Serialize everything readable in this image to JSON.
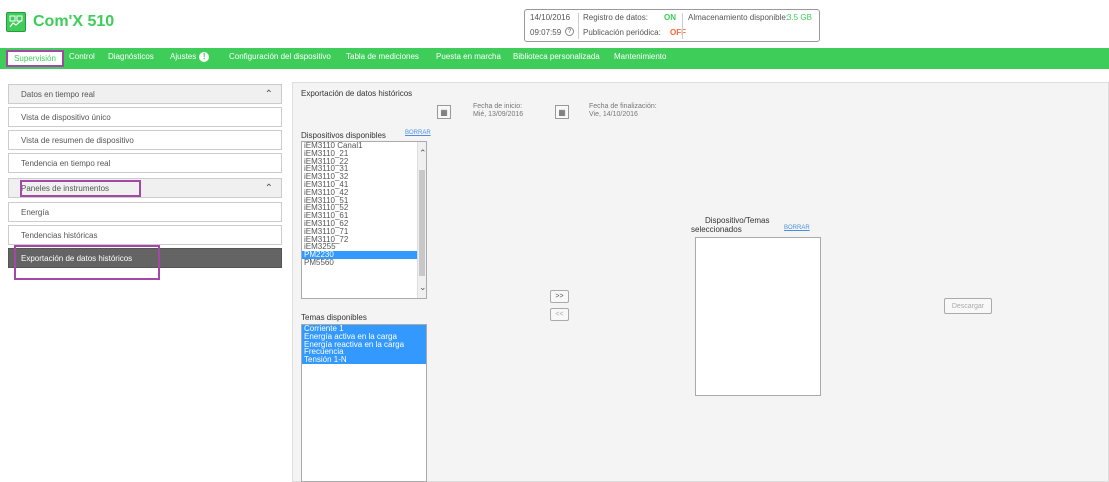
{
  "header": {
    "title": "Com'X 510",
    "date": "14/10/2016",
    "time": "09:07:59",
    "logging_label": "Registro de datos:",
    "logging_value": "ON",
    "publish_label": "Publicación periódica:",
    "publish_value": "OFF",
    "storage_label": "Almacenamiento disponible:",
    "storage_value": "3.5 GB"
  },
  "nav": {
    "tabs": [
      "Supervisión",
      "Control",
      "Diagnósticos",
      "Ajustes",
      "Configuración del dispositivo",
      "Tabla de mediciones",
      "Puesta en marcha",
      "Biblioteca personalizada",
      "Mantenimiento"
    ],
    "warning_symbol": "!"
  },
  "sidebar": {
    "group1": "Datos en tiempo real",
    "items1": [
      "Vista de dispositivo único",
      "Vista de resumen de dispositivo",
      "Tendencia en tiempo real"
    ],
    "group2": "Paneles de instrumentos",
    "items2": [
      "Energía",
      "Tendencias históricas",
      "Exportación de datos históricos"
    ]
  },
  "main": {
    "title": "Exportación de datos históricos",
    "start_label": "Fecha de inicio:",
    "start_value": "Mié, 13/09/2016",
    "end_label": "Fecha de finalización:",
    "end_value": "Vie, 14/10/2016",
    "devices_label": "Dispositivos disponibles",
    "clear_label": "BORRAR",
    "devices": [
      "iEM3110 Canal1",
      "iEM3110_21",
      "iEM3110_22",
      "iEM3110_31",
      "iEM3110_32",
      "iEM3110_41",
      "iEM3110_42",
      "iEM3110_51",
      "iEM3110_52",
      "iEM3110_61",
      "iEM3110_62",
      "iEM3110_71",
      "iEM3110_72",
      "iEM3255",
      "PM2230",
      "PM5560"
    ],
    "selected_device": "PM2230",
    "topics_label": "Temas disponibles",
    "topics": [
      "Corriente 1",
      "Energía activa en la carga",
      "Energía reactiva en la carga",
      "Frecuencia",
      "Tensión 1-N"
    ],
    "add_label": ">>",
    "remove_label": "<<",
    "selected_label_1": "Dispositivo/Temas",
    "selected_label_2": "seleccionados",
    "selected_clear_label": "BORRAR",
    "download_label": "Descargar"
  },
  "colors": {
    "brand": "#3dcd58",
    "on": "#3dcd58",
    "off": "#ff6633",
    "highlight": "#a348a6",
    "selection": "#3399ff"
  }
}
